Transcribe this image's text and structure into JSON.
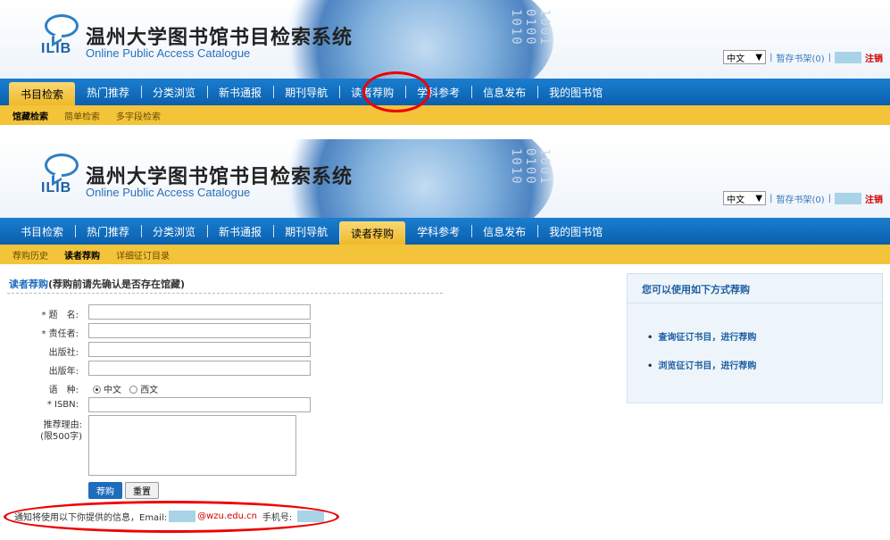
{
  "site": {
    "title": "温州大学图书馆书目检索系统",
    "subtitle": "Online Public Access Catalogue",
    "logo_text": "ILIB"
  },
  "toolbar": {
    "language": "中文",
    "cart": "暂存书架(0)",
    "separator": "|",
    "logout": "注销"
  },
  "nav": [
    "书目检索",
    "热门推荐",
    "分类浏览",
    "新书通报",
    "期刊导航",
    "读者荐购",
    "学科参考",
    "信息发布",
    "我的图书馆"
  ],
  "top": {
    "active_nav": "书目检索",
    "subnav": [
      "馆藏检索",
      "简单检索",
      "多字段检索"
    ]
  },
  "bottom": {
    "active_nav": "读者荐购",
    "subnav": [
      "荐购历史",
      "读者荐购",
      "详细征订目录"
    ]
  },
  "form": {
    "title_link": "读者荐购",
    "title_note": "(荐购前请先确认是否存在馆藏)",
    "labels": {
      "title": "* 题　名:",
      "author": "* 责任者:",
      "publisher": "出版社:",
      "year": "出版年:",
      "language": "语　种:",
      "isbn": "* ISBN:",
      "reason": "推荐理由:",
      "reason_limit": "(限500字)"
    },
    "language_options": [
      "中文",
      "西文"
    ],
    "language_selected": "中文",
    "submit": "荐购",
    "reset": "重置",
    "notice_prefix": "通知将使用以下你提供的信息，Email:",
    "email_domain": "@wzu.edu.cn",
    "phone_label": "手机号:"
  },
  "side": {
    "title": "您可以使用如下方式荐购",
    "links": [
      "查询征订书目，进行荐购",
      "浏览征订书目，进行荐购"
    ]
  },
  "colors": {
    "nav_blue": "#0a5fad",
    "subnav_yellow": "#f3c33a",
    "highlight_red": "#e00000"
  }
}
